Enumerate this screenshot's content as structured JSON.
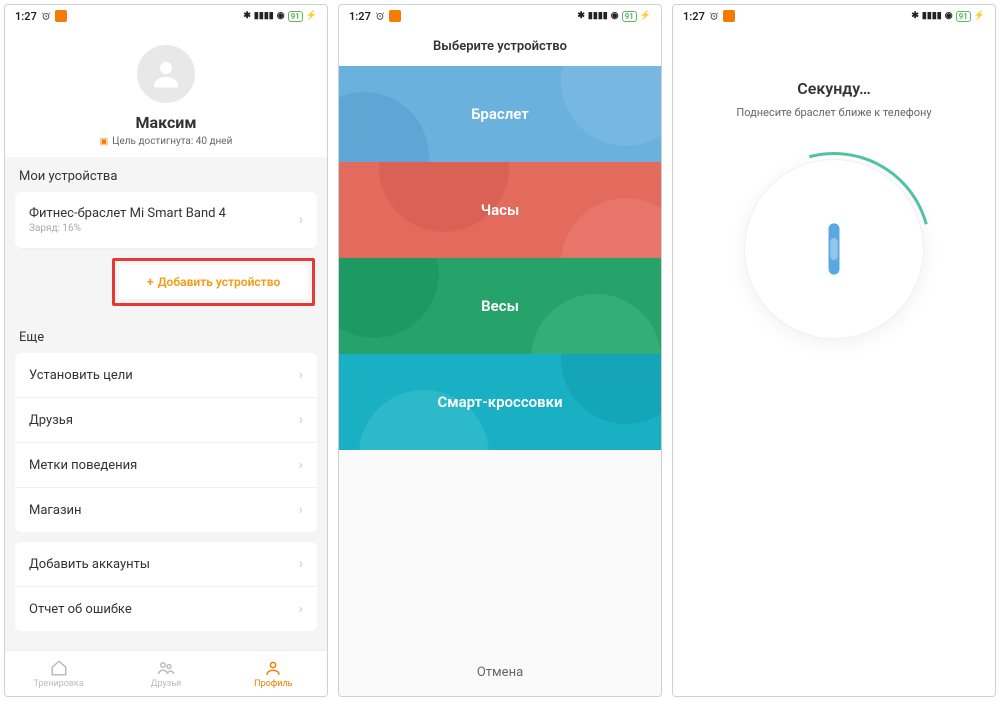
{
  "statusbar": {
    "time": "1:27",
    "battery": "91"
  },
  "screen1": {
    "username": "Максим",
    "goal_text": "Цель достигнута: 40 дней",
    "devices_label": "Мои устройства",
    "device_name": "Фитнес-браслет Mi Smart Band 4",
    "device_sub": "Заряд: 16%",
    "add_device": "Добавить устройство",
    "more_label": "Еще",
    "rows": {
      "goals": "Установить цели",
      "friends": "Друзья",
      "tags": "Метки поведения",
      "store": "Магазин",
      "accounts": "Добавить аккаунты",
      "bug": "Отчет об ошибке"
    },
    "tabs": {
      "train": "Тренировка",
      "friends": "Друзья",
      "profile": "Профиль"
    }
  },
  "screen2": {
    "title": "Выберите устройство",
    "bracelet": "Браслет",
    "watch": "Часы",
    "scale": "Весы",
    "shoes": "Смарт-кроссовки",
    "cancel": "Отмена"
  },
  "screen3": {
    "title": "Секунду…",
    "sub": "Поднесите браслет ближе к телефону"
  }
}
